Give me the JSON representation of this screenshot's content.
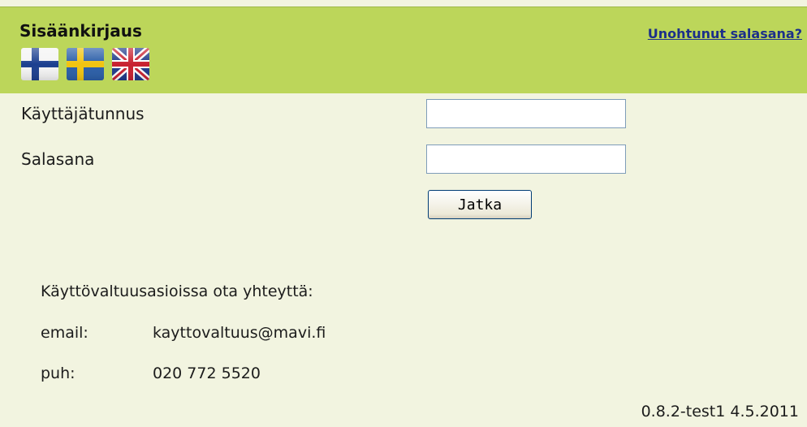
{
  "header": {
    "title": "Sisäänkirjaus",
    "forgot_password": "Unohtunut salasana?",
    "languages": [
      {
        "code": "fi",
        "icon": "finland-flag-icon"
      },
      {
        "code": "sv",
        "icon": "sweden-flag-icon"
      },
      {
        "code": "en",
        "icon": "uk-flag-icon"
      }
    ]
  },
  "form": {
    "username_label": "Käyttäjätunnus",
    "username_value": "",
    "password_label": "Salasana",
    "password_value": "",
    "submit_label": "Jatka"
  },
  "contact": {
    "heading": "Käyttövaltuusasioissa ota yhteyttä:",
    "email_label": "email:",
    "email_value": "kayttovaltuus@mavi.fi",
    "phone_label": "puh:",
    "phone_value": "020 772 5520"
  },
  "footer": {
    "version": "0.8.2-test1 4.5.2011"
  },
  "colors": {
    "background": "#f2f4e0",
    "header": "#bcd65a",
    "link": "#1c2f8a"
  }
}
